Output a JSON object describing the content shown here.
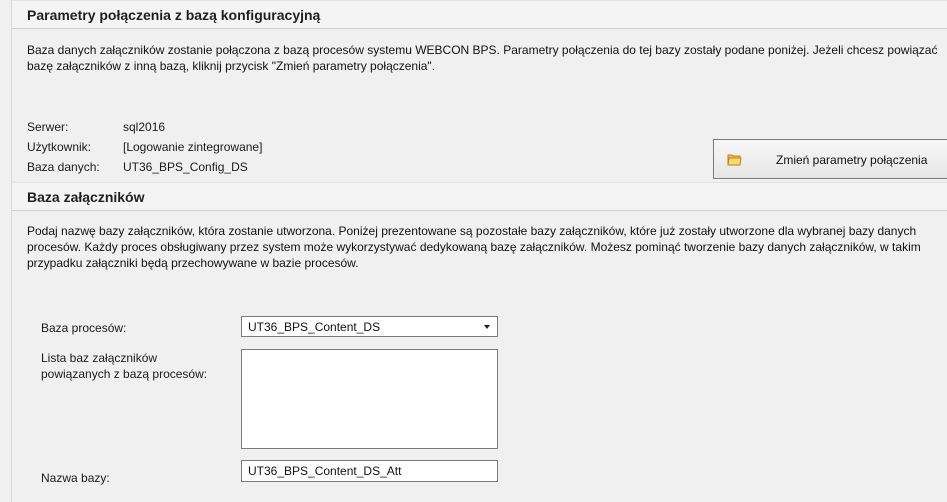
{
  "connection_section": {
    "title": "Parametry połączenia z bazą konfiguracyjną",
    "description": "Baza danych załączników zostanie połączona z bazą procesów systemu WEBCON BPS. Parametry połączenia do tej bazy zostały podane poniżej. Jeżeli chcesz powiązać bazę załączników z inną bazą, kliknij przycisk \"Zmień parametry połączenia\".",
    "server_label": "Serwer:",
    "server_value": "sql2016",
    "user_label": "Użytkownik:",
    "user_value": "[Logowanie zintegrowane]",
    "database_label": "Baza danych:",
    "database_value": "UT36_BPS_Config_DS",
    "change_button_label": "Zmień parametry połączenia",
    "change_button_icon": "folder-icon"
  },
  "attachments_section": {
    "title": "Baza załączników",
    "description": "Podaj nazwę bazy załączników, która zostanie utworzona. Poniżej prezentowane są pozostałe bazy załączników, które już zostały utworzone dla wybranej bazy danych procesów. Każdy proces obsługiwany przez system może wykorzystywać dedykowaną bazę załączników. Możesz pominąć tworzenie bazy danych załączników, w takim przypadku załączniki będą przechowywane w bazie procesów.",
    "process_db_label": "Baza procesów:",
    "process_db_selected": "UT36_BPS_Content_DS",
    "attachments_list_label_line1": "Lista baz załączników",
    "attachments_list_label_line2": "powiązanych z bazą procesów:",
    "attachments_list_items": [],
    "db_name_label": "Nazwa bazy:",
    "db_name_value": "UT36_BPS_Content_DS_Att"
  },
  "colors": {
    "background": "#f0f0f0",
    "section_header": "#f4f4f4",
    "border": "#7a7a7a",
    "icon": "#e7b640"
  }
}
